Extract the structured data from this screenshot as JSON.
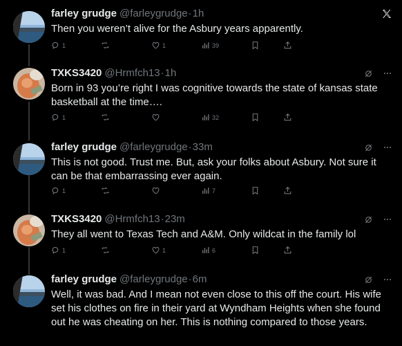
{
  "tweets": [
    {
      "name": "farley grudge",
      "handle": "@farleygrudge",
      "time": "1h",
      "text": "Then you weren’t  alive for the Asbury years apparently.",
      "replies": "1",
      "retweets": "",
      "likes": "1",
      "views": "39",
      "corner": "x-logo"
    },
    {
      "name": "TXKS3420",
      "handle": "@Hrmfch13",
      "time": "1h",
      "text": "Born in 93 you’re right I was cognitive towards the state of kansas state basketball at the time….",
      "replies": "1",
      "retweets": "",
      "likes": "",
      "views": "32",
      "corner": "grok-more"
    },
    {
      "name": "farley grudge",
      "handle": "@farleygrudge",
      "time": "33m",
      "text": "This is not good. Trust me. But, ask your folks about Asbury. Not sure it can be that embarrassing ever again.",
      "replies": "1",
      "retweets": "",
      "likes": "",
      "views": "7",
      "corner": "grok-more"
    },
    {
      "name": "TXKS3420",
      "handle": "@Hrmfch13",
      "time": "23m",
      "text": "They all went to Texas Tech and A&M. Only wildcat in the family lol",
      "replies": "1",
      "retweets": "",
      "likes": "1",
      "views": "6",
      "corner": "grok-more"
    },
    {
      "name": "farley grudge",
      "handle": "@farleygrudge",
      "time": "6m",
      "text": "Well, it was bad. And I mean not even close to this off the court. His wife set his clothes on fire in their yard at Wyndham Heights when she found out he was cheating on her. This is nothing compared to those years.",
      "replies": "",
      "retweets": "",
      "likes": "",
      "views": "",
      "corner": "grok-more"
    }
  ],
  "colors": {
    "background": "#000000",
    "text": "#e7e9ea",
    "muted": "#71767b",
    "thread_line": "#333639"
  }
}
